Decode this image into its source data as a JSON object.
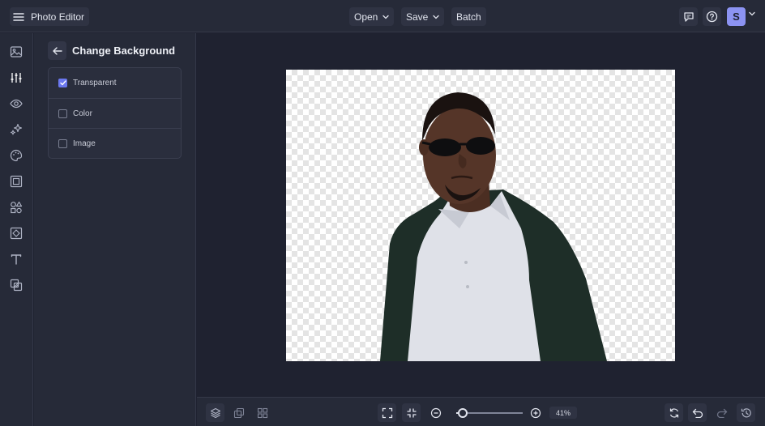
{
  "topbar": {
    "app_title": "Photo Editor",
    "menu_icon": "hamburger-icon",
    "open_label": "Open",
    "save_label": "Save",
    "batch_label": "Batch",
    "avatar_initial": "S"
  },
  "rail": {
    "items": [
      "image-icon",
      "sliders-icon",
      "eye-icon",
      "sparkle-icon",
      "palette-icon",
      "frame-icon",
      "shapes-icon",
      "texture-icon",
      "text-icon",
      "overlay-icon"
    ],
    "active": "sliders-icon"
  },
  "panel": {
    "title": "Change Background",
    "options": [
      {
        "label": "Transparent",
        "checked": true
      },
      {
        "label": "Color",
        "checked": false
      },
      {
        "label": "Image",
        "checked": false
      }
    ]
  },
  "bottombar": {
    "zoom_value": "41%",
    "zoom_fraction": 0.1
  },
  "colors": {
    "accent": "#6b78ef",
    "avatar": "#8c93f2",
    "background": "#1f2230",
    "panel": "#262a38"
  }
}
